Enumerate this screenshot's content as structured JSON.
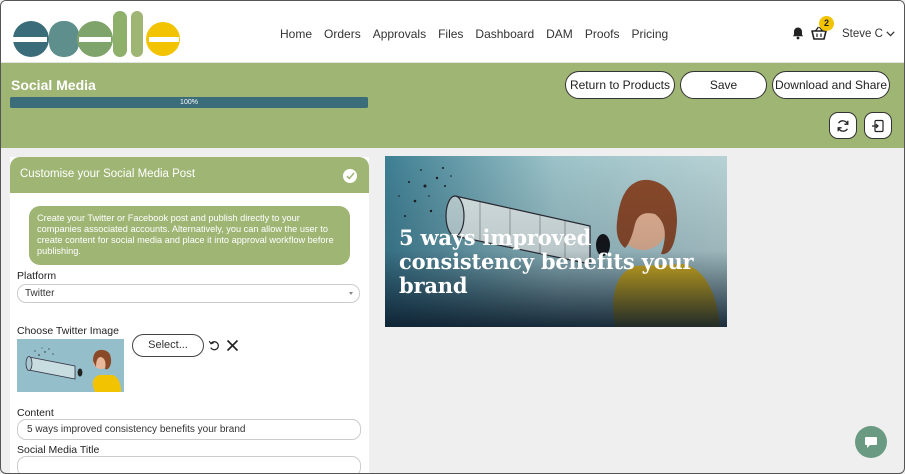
{
  "brand": {
    "logo_text": "enable",
    "colors": {
      "green": "#9fb574",
      "teal": "#3a6c79",
      "yellow": "#f2c300"
    }
  },
  "nav": {
    "items": [
      "Home",
      "Orders",
      "Approvals",
      "Files",
      "Dashboard",
      "DAM",
      "Proofs",
      "Pricing"
    ]
  },
  "header": {
    "cart_count": "2",
    "user_name": "Steve C",
    "icons": [
      "bell-icon",
      "basket-icon",
      "chevron-down-icon"
    ]
  },
  "toolbar": {
    "page_title": "Social Media",
    "progress_label": "100%",
    "progress_value": 100,
    "return_label": "Return to Products",
    "save_label": "Save",
    "download_label": "Download and Share",
    "icon_buttons": [
      "refresh-icon",
      "export-icon"
    ]
  },
  "panel": {
    "title": "Customise your Social Media Post",
    "info": "Create your Twitter or Facebook post and publish directly to your companies associated accounts. Alternatively, you can allow the user to create content for social media and place it into approval workflow before publishing.",
    "platform_label": "Platform",
    "platform_value": "Twitter",
    "image_label": "Choose Twitter Image",
    "select_button": "Select...",
    "content_label": "Content",
    "content_value": "5 ways improved consistency benefits your brand",
    "title_label": "Social Media Title",
    "title_value": ""
  },
  "preview": {
    "headline": "5 ways improved consistency benefits your brand"
  }
}
